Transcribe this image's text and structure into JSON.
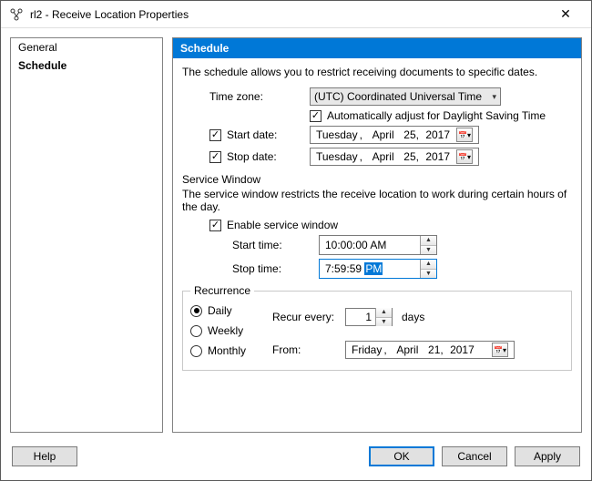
{
  "window": {
    "title": "rl2 - Receive Location Properties"
  },
  "nav": {
    "items": [
      {
        "label": "General",
        "selected": false
      },
      {
        "label": "Schedule",
        "selected": true
      }
    ]
  },
  "panel": {
    "title": "Schedule",
    "description": "The schedule allows you to restrict receiving documents to specific dates.",
    "timezone": {
      "label": "Time zone:",
      "value": "(UTC) Coordinated Universal Time"
    },
    "auto_dst": {
      "checked": true,
      "label": "Automatically adjust for Daylight Saving Time"
    },
    "start_date": {
      "checked": true,
      "label": "Start date:",
      "weekday": "Tuesday",
      "month": "April",
      "day": "25,",
      "year": "2017"
    },
    "stop_date": {
      "checked": true,
      "label": "Stop date:",
      "weekday": "Tuesday",
      "month": "April",
      "day": "25,",
      "year": "2017"
    },
    "service_window": {
      "group_label": "Service Window",
      "description": "The service window restricts the receive location to work during certain hours of the day.",
      "enable": {
        "checked": true,
        "label": "Enable service window"
      },
      "start_time": {
        "label": "Start time:",
        "value": "10:00:00 AM"
      },
      "stop_time": {
        "label": "Stop time:",
        "value_prefix": "7:59:59 ",
        "value_sel": "PM"
      }
    },
    "recurrence": {
      "legend": "Recurrence",
      "options": {
        "daily": "Daily",
        "weekly": "Weekly",
        "monthly": "Monthly",
        "selected": "daily"
      },
      "recur_label": "Recur every:",
      "recur_value": "1",
      "recur_unit": "days",
      "from_label": "From:",
      "from_date": {
        "weekday": "Friday",
        "month": "April",
        "day": "21,",
        "year": "2017"
      }
    }
  },
  "footer": {
    "help": "Help",
    "ok": "OK",
    "cancel": "Cancel",
    "apply": "Apply"
  }
}
